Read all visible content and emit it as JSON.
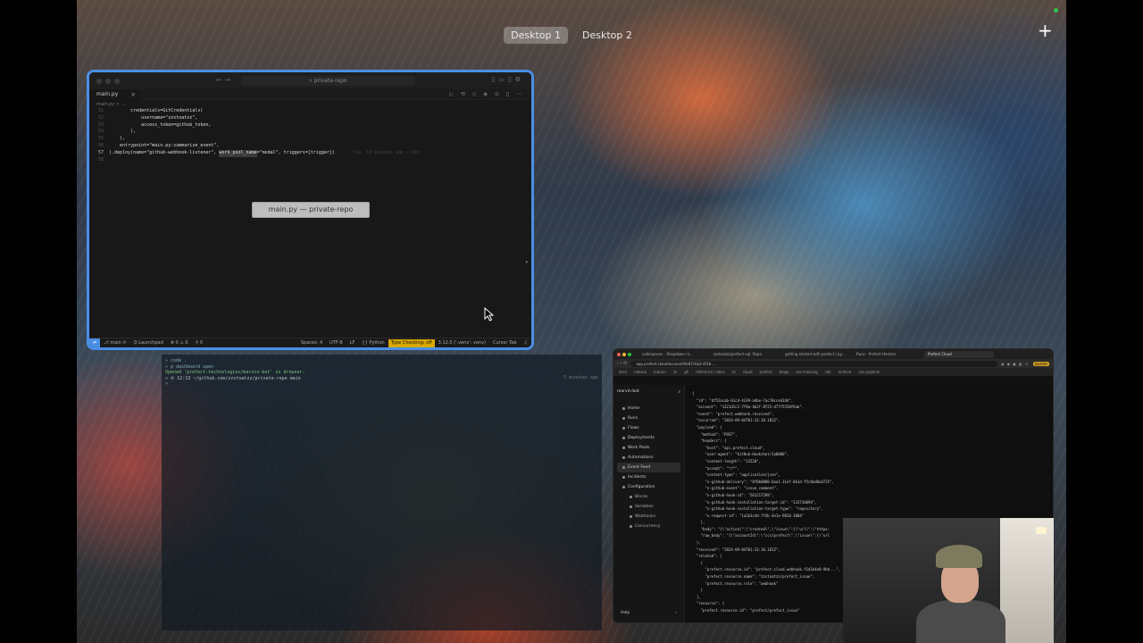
{
  "spaces": [
    {
      "label": "Desktop 1",
      "active": true
    },
    {
      "label": "Desktop 2",
      "active": false
    }
  ],
  "add_space_label": "+",
  "editor": {
    "search_text": "private-repo",
    "tab": "main.py",
    "breadcrumb": "main.py > ...",
    "lines": [
      {
        "n": "51",
        "text": "        credentials=GitCredentials("
      },
      {
        "n": "52",
        "text": "            username=\"zzstoatzz\","
      },
      {
        "n": "53",
        "text": "            access_token=github_token,"
      },
      {
        "n": "54",
        "text": "        ),"
      },
      {
        "n": "55",
        "text": "    ),"
      },
      {
        "n": "56",
        "text": "    entrypoint=\"main.py:summarize_event\","
      },
      {
        "n": "57",
        "text_before": ").deploy(name=\"github-webhook-listener\", ",
        "highlight": "work_pool_name",
        "text_after": "=\"modal\", triggers=[trigger])",
        "blame": "You, 19 minutes ago • Ref"
      },
      {
        "n": "58",
        "text": ""
      }
    ],
    "window_label": "main.py — private-repo",
    "status": {
      "branch": "main",
      "launchpad": "Launchpad",
      "problems": "⊗ 0 ⚠ 0",
      "ports": "0",
      "spaces": "Spaces: 4",
      "encoding": "UTF-8",
      "eol": "LF",
      "language": "Python",
      "type_checking": "Type Checking: off",
      "python_version": "3.12.5 ('.venv': venv)",
      "cursor_tab": "Cursor Tab"
    }
  },
  "terminal": {
    "lines": [
      "» code .",
      "» p dashboard open",
      "Opened 'prefect-technologies/marvin-bot' in browser.",
      "» ⟳ 12:13 ~/github.com/zzstoatzz/private-repo main",
      "» "
    ],
    "time": "3 minutes ago"
  },
  "browser": {
    "tabs": [
      "codespaces - Dropdown nl...",
      "zzstoatzz/prefect-sql: Repo",
      "getting started with prefect | py...",
      "Runs - Prefect Horizon",
      "Prefect Cloud"
    ],
    "url": "app.prefect.cloud/account/9c87c6a2-4f1b-...",
    "update_label": "Update",
    "bookmarks": [
      "docs",
      "nebula",
      "marvin",
      "zz",
      "gh",
      "reference / docs",
      "zz",
      "cloud",
      "prefect",
      "blogs",
      "oss tracking",
      "sdk",
      "archive",
      "oss projects"
    ],
    "sidebar": {
      "workspace": "marvin-bot",
      "items": [
        {
          "label": "Home",
          "sub": false,
          "active": false
        },
        {
          "label": "Runs",
          "sub": false,
          "active": false
        },
        {
          "label": "Flows",
          "sub": false,
          "active": false
        },
        {
          "label": "Deployments",
          "sub": false,
          "active": false
        },
        {
          "label": "Work Pools",
          "sub": false,
          "active": false
        },
        {
          "label": "Automations",
          "sub": false,
          "active": false
        },
        {
          "label": "Event Feed",
          "sub": false,
          "active": true
        },
        {
          "label": "Incidents",
          "sub": false,
          "active": false
        },
        {
          "label": "Configuration",
          "sub": false,
          "active": false
        },
        {
          "label": "Blocks",
          "sub": true,
          "active": false
        },
        {
          "label": "Variables",
          "sub": true,
          "active": false
        },
        {
          "label": "Webhooks",
          "sub": true,
          "active": false
        },
        {
          "label": "Concurrency",
          "sub": true,
          "active": false
        }
      ],
      "help": "Help"
    },
    "json_lines": [
      "{",
      "  \"id\": \"df52acab-61cd-4339-adbe-7ac70cce434d\",",
      "  \"account\": \"1321d1c2-7f0a-4b2f-8f25-d77f5550f6ab\",",
      "  \"event\": \"prefect.webhook.received\",",
      "  \"occurred\": \"2024-09-04T01:32:10.181Z\",",
      "  \"payload\": {",
      "    \"method\": \"POST\",",
      "    \"headers\": {",
      "      \"host\": \"api.prefect.cloud\",",
      "      \"user-agent\": \"GitHub-Hookshot/1a0000\",",
      "      \"content-length\": \"13520\",",
      "      \"accept\": \"*/*\",",
      "      \"content-type\": \"application/json\",",
      "      \"x-github-delivery\": \"8f8b0000-6aa1-11ef-8b1d-f5c8ed0ad735\",",
      "      \"x-github-event\": \"issue_comment\",",
      "      \"x-github-hook-id\": \"501217298\",",
      "      \"x-github-hook-installation-target-id\": \"133734094\",",
      "      \"x-github-hook-installation-target-type\": \"repository\",",
      "      \"x-request-id\": \"1a2b3c4d-7f4b-4e1e-9820-3004\"",
      "    },",
      "    \"body\": \"{\\\"action\\\":\\\"created\\\",\\\"issue\\\":{\\\"url\\\":\\\"https:",
      "    \"raw_body\": \"{\\\"accountId\\\":\\\"ccs/prefect\\\",\\\"issue\\\":{\\\"url",
      "  },",
      "  \"received\": \"2024-09-04T01:32:10.181Z\",",
      "  \"related\": [",
      "    {",
      "      \"prefect.resource.id\": \"prefect-cloud.webhook.f1d1b4e0-9bb...\",",
      "      \"prefect.resource.name\": \"zzstoatzz/prefect_issue\",",
      "      \"prefect.resource.role\": \"webhook\"",
      "    }",
      "  ],",
      "  \"resource\": {",
      "    \"prefect.resource.id\": \"prefect/prefect_issue\""
    ]
  }
}
